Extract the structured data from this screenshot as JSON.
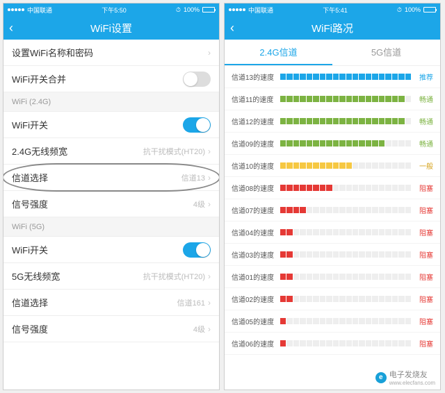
{
  "left": {
    "status": {
      "carrier": "中国联通",
      "time": "下午5:50",
      "battery": "100%"
    },
    "header": {
      "title": "WiFi设置"
    },
    "rows": {
      "name_pwd": "设置WiFi名称和密码",
      "merge": "WiFi开关合并",
      "sec24": "WiFi (2.4G)",
      "switch24": "WiFi开关",
      "bw24": {
        "label": "2.4G无线频宽",
        "value": "抗干扰模式(HT20)"
      },
      "channel24": {
        "label": "信道选择",
        "value": "信道13"
      },
      "signal24": {
        "label": "信号强度",
        "value": "4级"
      },
      "sec5": "WiFi (5G)",
      "switch5": "WiFi开关",
      "bw5": {
        "label": "5G无线频宽",
        "value": "抗干扰模式(HT20)"
      },
      "channel5": {
        "label": "信道选择",
        "value": "信道161"
      },
      "signal5": {
        "label": "信号强度",
        "value": "4级"
      }
    }
  },
  "right": {
    "status": {
      "carrier": "中国联通",
      "time": "下午5:41",
      "battery": "100%"
    },
    "header": {
      "title": "WiFi路况"
    },
    "tabs": {
      "t24": "2.4G信道",
      "t5": "5G信道"
    },
    "channels": [
      {
        "label": "信道13的速度",
        "filled": 20,
        "total": 20,
        "color": "blue",
        "status": "推荐"
      },
      {
        "label": "信道11的速度",
        "filled": 19,
        "total": 20,
        "color": "green",
        "status": "畅通"
      },
      {
        "label": "信道12的速度",
        "filled": 19,
        "total": 20,
        "color": "green",
        "status": "畅通"
      },
      {
        "label": "信道09的速度",
        "filled": 16,
        "total": 20,
        "color": "green",
        "status": "畅通"
      },
      {
        "label": "信道10的速度",
        "filled": 11,
        "total": 20,
        "color": "yellow",
        "status": "一般"
      },
      {
        "label": "信道08的速度",
        "filled": 8,
        "total": 20,
        "color": "red",
        "status": "阻塞"
      },
      {
        "label": "信道07的速度",
        "filled": 4,
        "total": 20,
        "color": "red",
        "status": "阻塞"
      },
      {
        "label": "信道04的速度",
        "filled": 2,
        "total": 20,
        "color": "red",
        "status": "阻塞"
      },
      {
        "label": "信道03的速度",
        "filled": 2,
        "total": 20,
        "color": "red",
        "status": "阻塞"
      },
      {
        "label": "信道01的速度",
        "filled": 2,
        "total": 20,
        "color": "red",
        "status": "阻塞"
      },
      {
        "label": "信道02的速度",
        "filled": 2,
        "total": 20,
        "color": "red",
        "status": "阻塞"
      },
      {
        "label": "信道05的速度",
        "filled": 1,
        "total": 20,
        "color": "red",
        "status": "阻塞"
      },
      {
        "label": "信道06的速度",
        "filled": 1,
        "total": 20,
        "color": "red",
        "status": "阻塞"
      }
    ]
  },
  "watermark": {
    "brand": "电子发烧友",
    "url": "www.elecfans.com"
  }
}
